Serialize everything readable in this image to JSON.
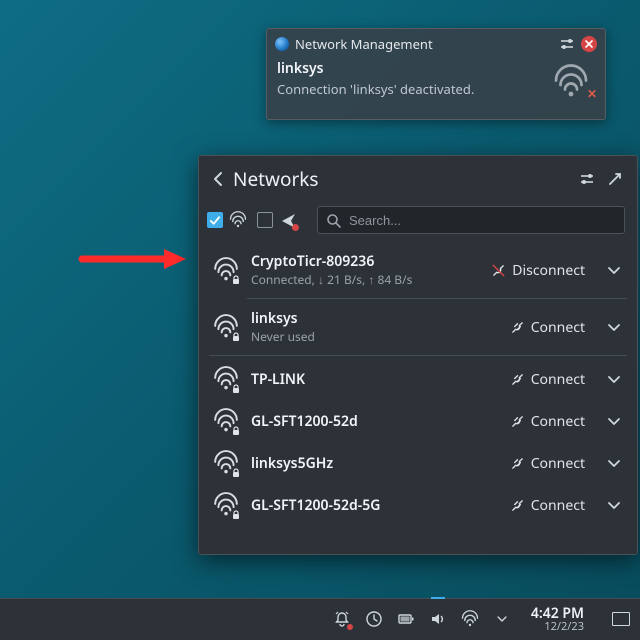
{
  "notification": {
    "title": "Network Management",
    "ssid": "linksys",
    "message": "Connection 'linksys' deactivated."
  },
  "panel": {
    "title": "Networks",
    "search_placeholder": "Search...",
    "filter_wifi_checked": true,
    "filter_airplane_checked": false,
    "networks": [
      {
        "ssid": "CryptoTicr-809236",
        "sub": "Connected,  ↓ 21 B/s,  ↑ 84 B/s",
        "action": "Disconnect",
        "secure": true,
        "connected": true
      },
      {
        "ssid": "linksys",
        "sub": "Never used",
        "action": "Connect",
        "secure": true
      },
      {
        "ssid": "TP-LINK",
        "sub": "",
        "action": "Connect",
        "secure": true
      },
      {
        "ssid": "GL-SFT1200-52d",
        "sub": "",
        "action": "Connect",
        "secure": true
      },
      {
        "ssid": "linksys5GHz",
        "sub": "",
        "action": "Connect",
        "secure": true
      },
      {
        "ssid": "GL-SFT1200-52d-5G",
        "sub": "",
        "action": "Connect",
        "secure": true
      }
    ]
  },
  "tray": {
    "time": "4:42 PM",
    "date": "12/2/23"
  }
}
